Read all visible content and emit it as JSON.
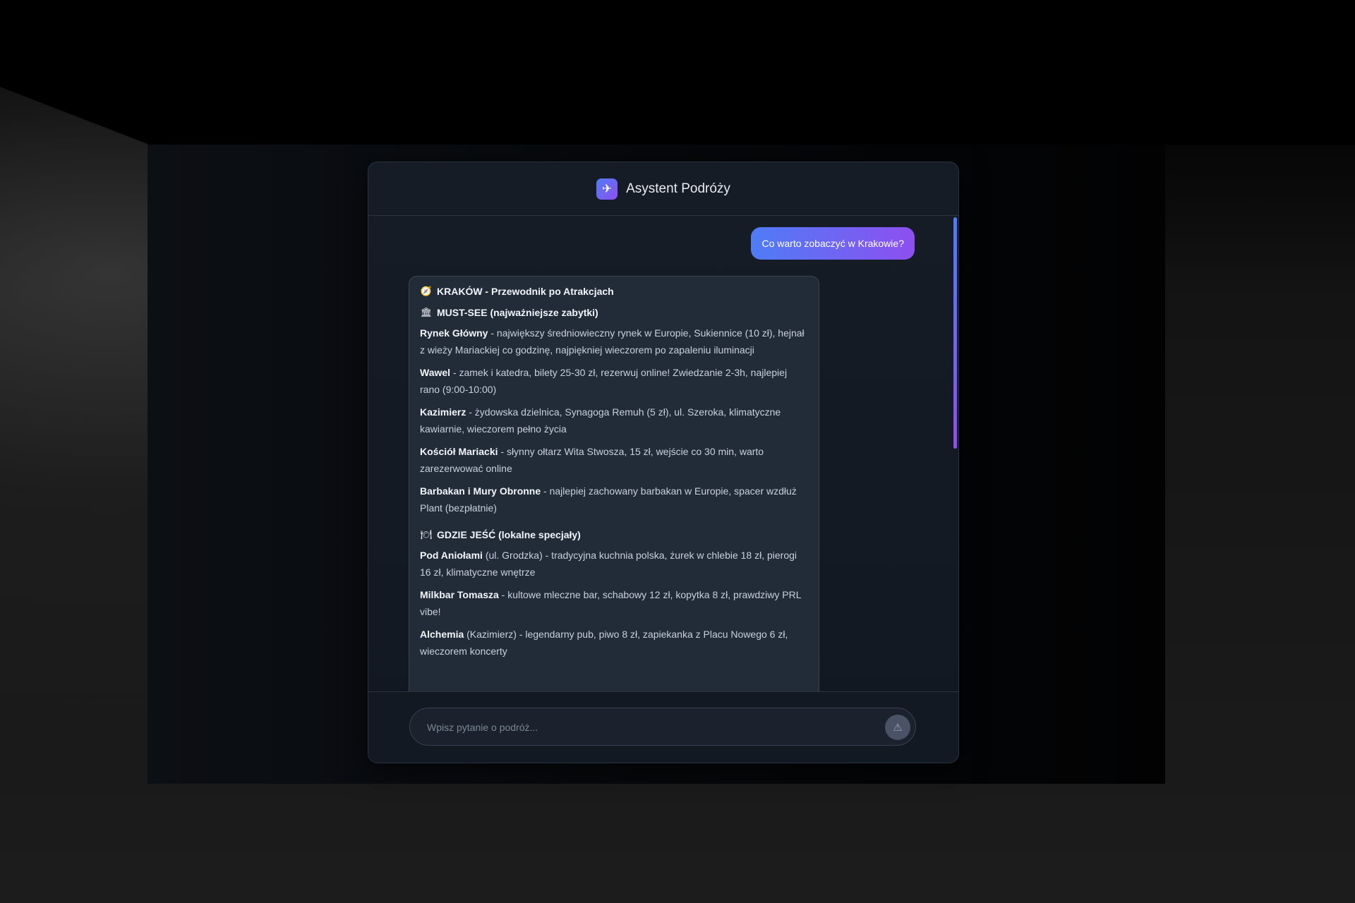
{
  "header": {
    "logo_glyph": "✈",
    "title": "Asystent Podróży"
  },
  "conversation": {
    "user_message": "Co warto zobaczyć w Krakowie?",
    "bot_message": {
      "title_icon": "🧭",
      "title": "KRAKÓW - Przewodnik po Atrakcjach",
      "sections": [
        {
          "icon": "🏛",
          "title": "MUST-SEE (najważniejsze zabytki)",
          "items": [
            {
              "name": "Rynek Główny",
              "text": " - największy średniowieczny rynek w Europie, Sukiennice (10 zł), hejnał z wieży Mariackiej co godzinę, najpiękniej wieczorem po zapaleniu iluminacji"
            },
            {
              "name": "Wawel",
              "text": " - zamek i katedra, bilety 25-30 zł, rezerwuj online! Zwiedzanie 2-3h, najlepiej rano (9:00-10:00)"
            },
            {
              "name": "Kazimierz",
              "text": " - żydowska dzielnica, Synagoga Remuh (5 zł), ul. Szeroka, klimatyczne kawiarnie, wieczorem pełno życia"
            },
            {
              "name": "Kościół Mariacki",
              "text": " - słynny ołtarz Wita Stwosza, 15 zł, wejście co 30 min, warto zarezerwować online"
            },
            {
              "name": "Barbakan i Mury Obronne",
              "text": " - najlepiej zachowany barbakan w Europie, spacer wzdłuż Plant (bezpłatnie)"
            }
          ]
        },
        {
          "icon": "🍽",
          "title": "GDZIE JEŚĆ (lokalne specjały)",
          "items": [
            {
              "name": "Pod Aniołami",
              "text": " (ul. Grodzka) - tradycyjna kuchnia polska, żurek w chlebie 18 zł, pierogi 16 zł, klimatyczne wnętrze"
            },
            {
              "name": "Milkbar Tomasza",
              "text": " - kultowe mleczne bar, schabowy 12 zł, kopytka 8 zł, prawdziwy PRL vibe!"
            },
            {
              "name": "Alchemia",
              "text": " (Kazimierz) - legendarny pub, piwo 8 zł, zapiekanka z Placu Nowego 6 zł, wieczorem koncerty"
            }
          ]
        }
      ]
    }
  },
  "composer": {
    "placeholder": "Wpisz pytanie o podróż...",
    "send_glyph": "⚠"
  },
  "colors": {
    "accent_start": "#4f7cf7",
    "accent_end": "#8d4ff0"
  }
}
